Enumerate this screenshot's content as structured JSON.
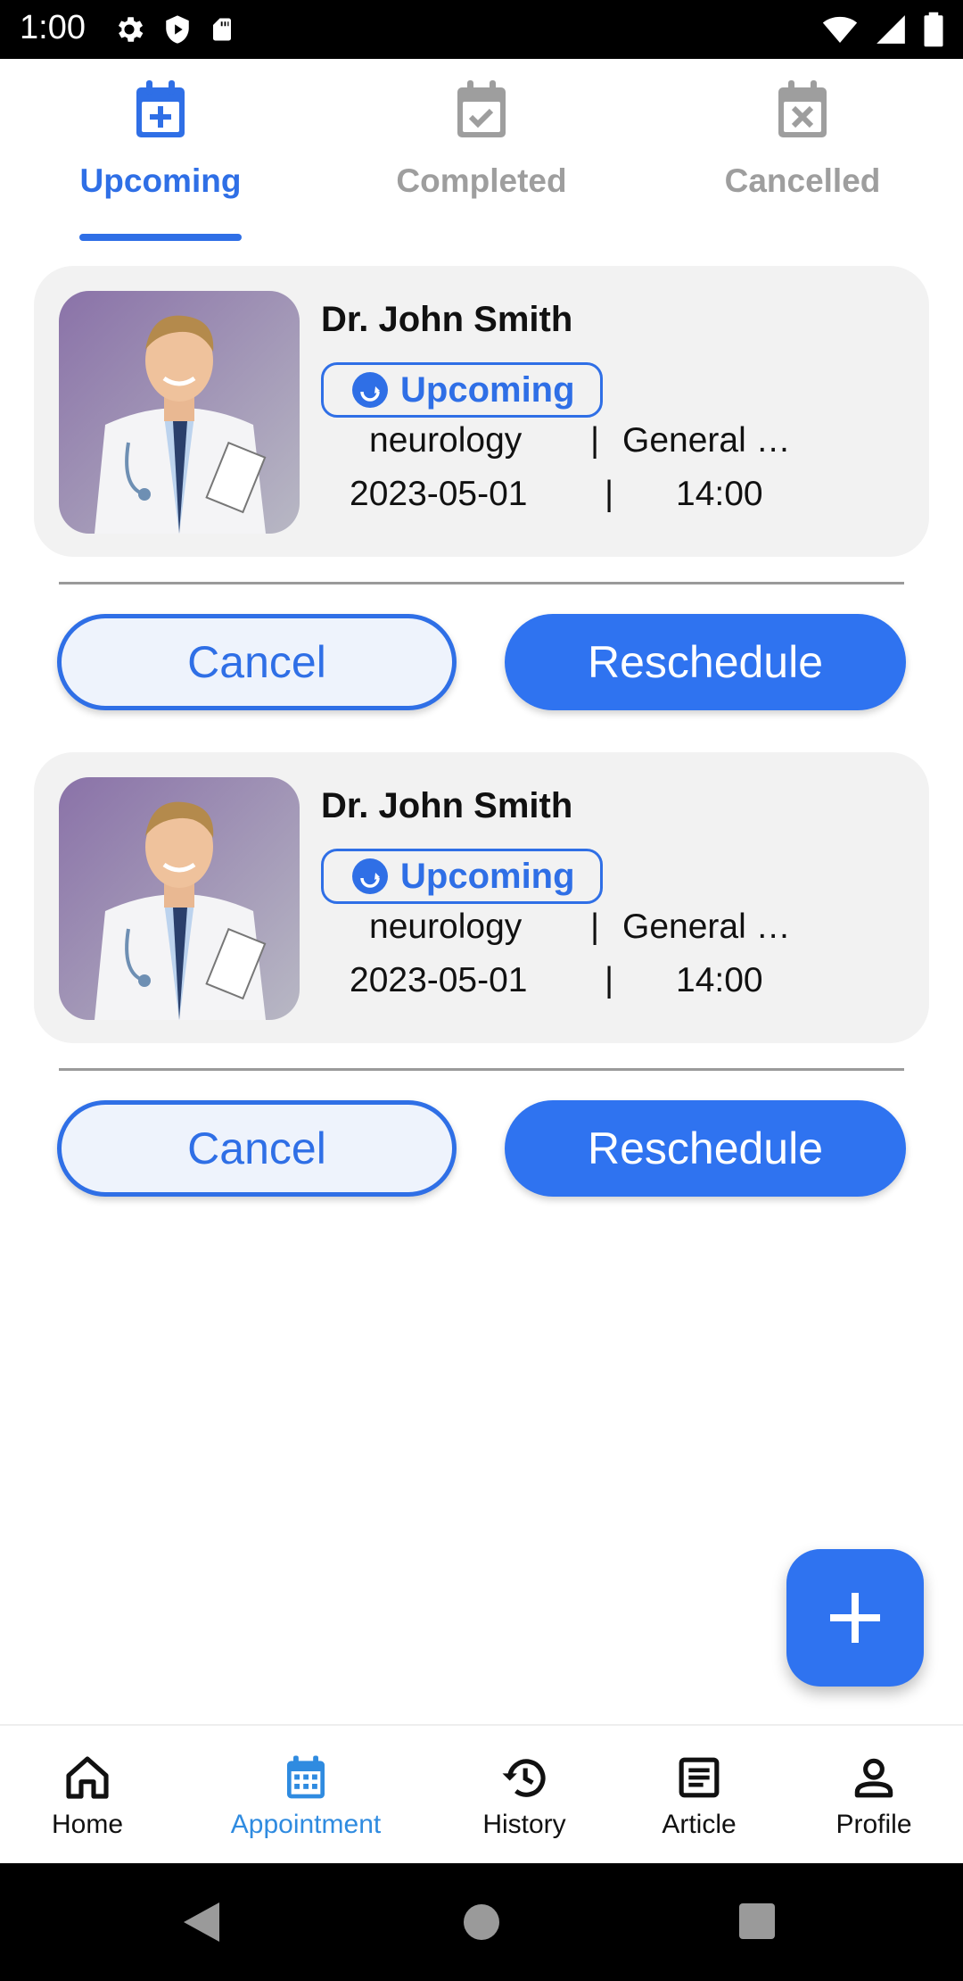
{
  "status_bar": {
    "time": "1:00"
  },
  "tabs": [
    {
      "label": "Upcoming",
      "icon": "calendar-plus-icon",
      "active": true
    },
    {
      "label": "Completed",
      "icon": "calendar-check-icon",
      "active": false
    },
    {
      "label": "Cancelled",
      "icon": "calendar-x-icon",
      "active": false
    }
  ],
  "appointments": [
    {
      "doctor_name": "Dr. John Smith",
      "status": "Upcoming",
      "specialty": "neurology",
      "separator": "|",
      "category": "General …",
      "date": "2023-05-01",
      "time": "14:00",
      "cancel_label": "Cancel",
      "reschedule_label": "Reschedule"
    },
    {
      "doctor_name": "Dr. John Smith",
      "status": "Upcoming",
      "specialty": "neurology",
      "separator": "|",
      "category": "General …",
      "date": "2023-05-01",
      "time": "14:00",
      "cancel_label": "Cancel",
      "reschedule_label": "Reschedule"
    }
  ],
  "fab": {
    "icon": "plus-icon"
  },
  "bottom_nav": [
    {
      "label": "Home",
      "icon": "home-icon",
      "active": false
    },
    {
      "label": "Appointment",
      "icon": "calendar-icon",
      "active": true
    },
    {
      "label": "History",
      "icon": "history-icon",
      "active": false
    },
    {
      "label": "Article",
      "icon": "article-icon",
      "active": false
    },
    {
      "label": "Profile",
      "icon": "person-icon",
      "active": false
    }
  ],
  "colors": {
    "accent": "#2f6fe6",
    "button_fill": "#2f73f0",
    "inactive_tab": "#9e9e9e",
    "card_bg": "#f2f2f2",
    "nav_active": "#2f8be0"
  }
}
